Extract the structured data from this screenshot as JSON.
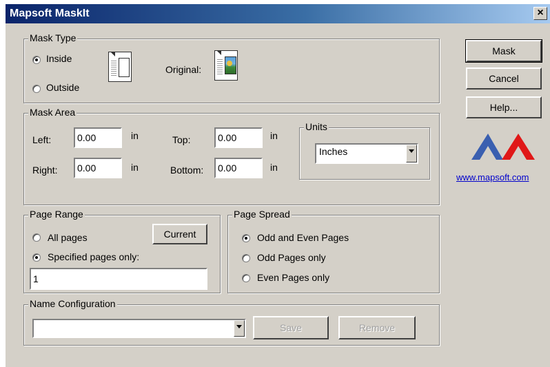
{
  "window": {
    "title": "Mapsoft MaskIt",
    "close_glyph": "×"
  },
  "mask_type": {
    "legend": "Mask Type",
    "inside_label": "Inside",
    "outside_label": "Outside",
    "selected": "inside",
    "original_label": "Original:"
  },
  "mask_area": {
    "legend": "Mask Area",
    "left_label": "Left:",
    "left_value": "0.00",
    "right_label": "Right:",
    "right_value": "0.00",
    "top_label": "Top:",
    "top_value": "0.00",
    "bottom_label": "Bottom:",
    "bottom_value": "0.00",
    "unit_suffix": "in",
    "units": {
      "legend": "Units",
      "selected": "Inches"
    }
  },
  "page_range": {
    "legend": "Page Range",
    "all_label": "All pages",
    "specified_label": "Specified pages only:",
    "selected": "specified",
    "current_button": "Current",
    "pages_value": "1"
  },
  "page_spread": {
    "legend": "Page Spread",
    "options": [
      "Odd and Even Pages",
      "Odd Pages only",
      "Even Pages only"
    ],
    "selected_index": 0
  },
  "name_config": {
    "legend": "Name Configuration",
    "selected": "",
    "save_button": "Save",
    "remove_button": "Remove"
  },
  "actions": {
    "mask_button": "Mask",
    "cancel_button": "Cancel",
    "help_button": "Help..."
  },
  "brand": {
    "link_text": "www.mapsoft.com",
    "logo_left_color": "#3a5fb0",
    "logo_right_color": "#e01818"
  }
}
